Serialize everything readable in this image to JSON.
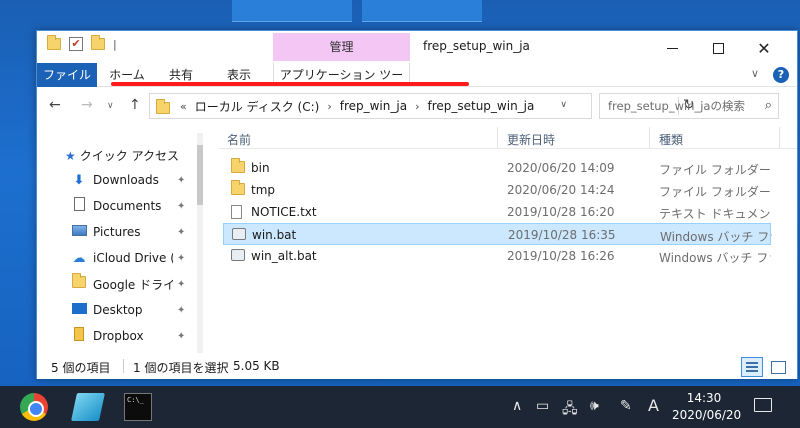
{
  "window": {
    "title": "frep_setup_win_ja",
    "context_group_label": "管理",
    "controls": {
      "minimize": "—",
      "maximize": "□",
      "close": "✕"
    }
  },
  "qat": {
    "check_glyph": "✔",
    "separator": "|"
  },
  "ribbon": {
    "tabs": [
      "ファイル",
      "ホーム",
      "共有",
      "表示",
      "アプリケーション ツール"
    ],
    "collapse_glyph": "∨",
    "help_glyph": "?"
  },
  "navbar": {
    "back": "←",
    "forward": "→",
    "history": "∨",
    "up": "↑",
    "address": {
      "overflow": "«",
      "separator": "›",
      "segments": [
        "ローカル ディスク (C:)",
        "frep_win_ja",
        "frep_setup_win_ja"
      ],
      "dropdown": "∨",
      "refresh": "↻"
    },
    "search_placeholder": "frep_setup_win_jaの検索",
    "search_icon": "⌕"
  },
  "nav_pane": {
    "quick_access": "クイック アクセス",
    "items": [
      {
        "label": "Downloads",
        "icon": "download-icon",
        "pinned": true
      },
      {
        "label": "Documents",
        "icon": "documents-icon",
        "pinned": true
      },
      {
        "label": "Pictures",
        "icon": "pictures-icon",
        "pinned": true
      },
      {
        "label": "iCloud Drive (",
        "icon": "cloud-icon",
        "pinned": true
      },
      {
        "label": "Google ドライブ",
        "icon": "folder-icon",
        "pinned": true
      },
      {
        "label": "Desktop",
        "icon": "desktop-icon",
        "pinned": true
      },
      {
        "label": "Dropbox",
        "icon": "dropbox-icon",
        "pinned": true
      }
    ],
    "pin_glyph": "📌"
  },
  "list": {
    "columns": [
      "名前",
      "更新日時",
      "種類"
    ],
    "rows": [
      {
        "name": "bin",
        "date": "2020/06/20 14:09",
        "type": "ファイル フォルダー",
        "icon": "folder-icon",
        "selected": false
      },
      {
        "name": "tmp",
        "date": "2020/06/20 14:24",
        "type": "ファイル フォルダー",
        "icon": "folder-icon",
        "selected": false
      },
      {
        "name": "NOTICE.txt",
        "date": "2019/10/28 16:20",
        "type": "テキスト ドキュメント",
        "icon": "text-file-icon",
        "selected": false
      },
      {
        "name": "win.bat",
        "date": "2019/10/28 16:35",
        "type": "Windows バッチ ファ...",
        "icon": "batch-file-icon",
        "selected": true
      },
      {
        "name": "win_alt.bat",
        "date": "2019/10/28 16:26",
        "type": "Windows バッチ ファ...",
        "icon": "batch-file-icon",
        "selected": false
      }
    ]
  },
  "status": {
    "item_count": "5 個の項目",
    "selection": "1 個の項目を選択",
    "size": "5.05 KB"
  },
  "taskbar": {
    "tray": {
      "chevron": "∧",
      "battery": "▭",
      "network": "🖧",
      "volume": "🕪",
      "pen": "✎",
      "ime": "A"
    },
    "time": "14:30",
    "date": "2020/06/20"
  },
  "colors": {
    "desktop": "#1560bd",
    "ribbon_file_tab": "#1b62b7",
    "context_tab": "#f3c6f4",
    "selection": "#cce8ff",
    "annotation_underline": "#ff1a1a",
    "taskbar": "#1c2634"
  }
}
